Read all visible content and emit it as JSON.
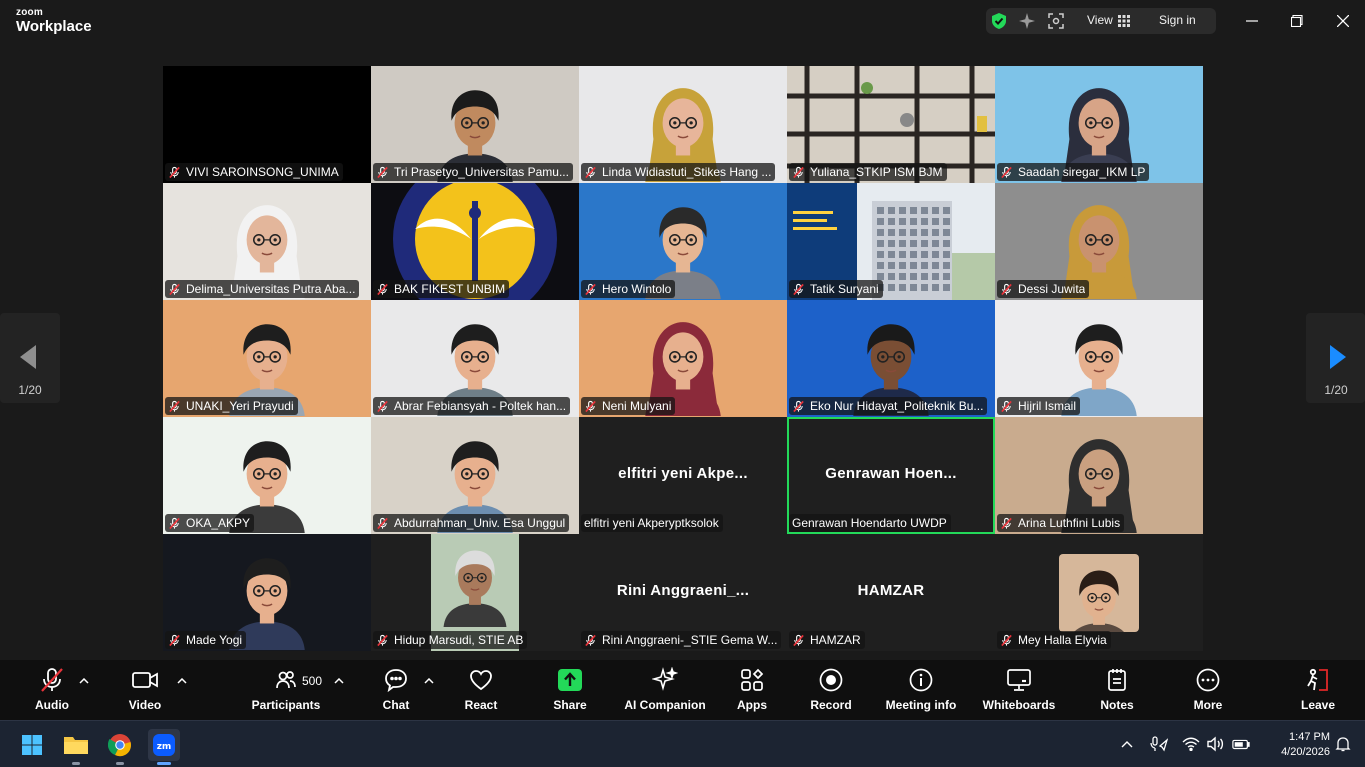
{
  "app": {
    "brand_top": "zoom",
    "brand_bottom": "Workplace"
  },
  "titlebar": {
    "view_label": "View",
    "signin_label": "Sign in"
  },
  "nav": {
    "page_left": "1/20",
    "page_right": "1/20"
  },
  "participants": [
    {
      "name": "VIVI SAROINSONG_UNIMA",
      "bg": "#000000",
      "type": "blank"
    },
    {
      "name": "Tri Prasetyo_Universitas Pamu...",
      "bg": "#cfcac3",
      "type": "person",
      "skin": "#c08a5f",
      "hair": "#1b1b1b",
      "shirt": "#2b2e36"
    },
    {
      "name": "Linda Widiastuti_Stikes Hang ...",
      "bg": "#e8e8ea",
      "type": "hijab",
      "skin": "#e7b59a",
      "hair": "#c7a23a",
      "shirt": "#c7a23a"
    },
    {
      "name": "Yuliana_STKIP ISM BJM",
      "bg": "#cfc7bb",
      "type": "shelf"
    },
    {
      "name": "Saadah siregar_IKM LP",
      "bg": "#7ec3e8",
      "type": "hijab",
      "skin": "#d7a487",
      "hair": "#2b2e3d",
      "shirt": "#3a3e52"
    },
    {
      "name": "Delima_Universitas Putra Aba...",
      "bg": "#e6e3de",
      "type": "hijab",
      "skin": "#e3b69b",
      "hair": "#f2f2f2",
      "shirt": "#f2f2f2"
    },
    {
      "name": "BAK FIKEST UNBIM",
      "bg": "#0d0d12",
      "type": "logo"
    },
    {
      "name": "Hero Wintolo",
      "bg": "#2b77c9",
      "type": "avatar",
      "skin": "#e6b693",
      "hair": "#2a2a2a",
      "shirt": "#7b7f88"
    },
    {
      "name": "Tatik Suryani",
      "bg": "#dde3ea",
      "type": "building"
    },
    {
      "name": "Dessi Juwita",
      "bg": "#8e8e8e",
      "type": "hijab",
      "skin": "#c9926f",
      "hair": "#c89a3a",
      "shirt": "#c89a3a"
    },
    {
      "name": "UNAKI_Yeri Prayudi",
      "bg": "#e7a66f",
      "type": "avatar",
      "skin": "#e7b08e",
      "hair": "#1e1e1e",
      "shirt": "#9aa6b3"
    },
    {
      "name": "Abrar Febiansyah - Poltek han...",
      "bg": "#e9e9ea",
      "type": "avatar",
      "skin": "#e7b08e",
      "hair": "#1e1e1e",
      "shirt": "#6f7f88"
    },
    {
      "name": "Neni Mulyani",
      "bg": "#e7a66f",
      "type": "hijab",
      "skin": "#e7b08e",
      "hair": "#8b2a3a",
      "shirt": "#8b2a3a"
    },
    {
      "name": "Eko Nur Hidayat_Politeknik Bu...",
      "bg": "#1d61c9",
      "type": "avatar",
      "skin": "#7a4e34",
      "hair": "#1a1a1a",
      "shirt": "#1e2a4a"
    },
    {
      "name": "Hijril Ismail",
      "bg": "#ececee",
      "type": "avatar",
      "skin": "#e7b08e",
      "hair": "#1e1e1e",
      "shirt": "#7fa6c8"
    },
    {
      "name": "OKA_AKPY",
      "bg": "#eef3ee",
      "type": "avatar",
      "skin": "#e7b08e",
      "hair": "#1e1e1e",
      "shirt": "#3b3b3b"
    },
    {
      "name": "Abdurrahman_Univ. Esa Unggul",
      "bg": "#d8d2c8",
      "type": "avatar",
      "skin": "#e7b08e",
      "hair": "#1e1e1e",
      "shirt": "#6c8eb0"
    },
    {
      "name": "elfitri yeni Akperyptksolok",
      "bg": "#1f1f1f",
      "type": "text",
      "display": "elfitri  yeni  Akpe...",
      "nomic": true
    },
    {
      "name": "Genrawan Hoendarto UWDP",
      "bg": "#1f1f1f",
      "type": "text",
      "display": "Genrawan  Hoen...",
      "nomic": true,
      "speaking": true
    },
    {
      "name": "Arina Luthfini Lubis",
      "bg": "#c9ab8e",
      "type": "hijab",
      "skin": "#caa080",
      "hair": "#2e2e2e",
      "shirt": "#2e2e2e"
    },
    {
      "name": "Made Yogi",
      "bg": "#15181f",
      "type": "avatar",
      "skin": "#e7b08e",
      "hair": "#1e1e1e",
      "shirt": "#2f3a5a"
    },
    {
      "name": "Hidup Marsudi, STIE AB",
      "bg": "#1f1f1f",
      "type": "portrait",
      "pbg": "#b9cbb5",
      "skin": "#a97a5c",
      "hair": "#dcdcdc",
      "shirt": "#3a3a3a"
    },
    {
      "name": "Rini Anggraeni-_STIE Gema W...",
      "bg": "#1f1f1f",
      "type": "text",
      "display": "Rini  Anggraeni_..."
    },
    {
      "name": "HAMZAR",
      "bg": "#1f1f1f",
      "type": "text",
      "display": "HAMZAR"
    },
    {
      "name": "Mey Halla Elyvia",
      "bg": "#1f1f1f",
      "type": "portrait",
      "pbg": "#d6b79a",
      "skin": "#e1b28f",
      "hair": "#2a1d16",
      "shirt": "#5a4a40"
    }
  ],
  "toolbar": {
    "audio": "Audio",
    "video": "Video",
    "participants": "Participants",
    "participants_count": "500",
    "chat": "Chat",
    "react": "React",
    "share": "Share",
    "ai": "AI Companion",
    "apps": "Apps",
    "record": "Record",
    "meeting_info": "Meeting info",
    "whiteboards": "Whiteboards",
    "notes": "Notes",
    "more": "More",
    "leave": "Leave"
  },
  "colors": {
    "share_green": "#23d959",
    "speaking_border": "#23d959",
    "leave_red": "#e02828",
    "mic_off": "#e8333a"
  },
  "taskbar": {
    "time": "1:47 PM",
    "date": "4/20/2026"
  }
}
